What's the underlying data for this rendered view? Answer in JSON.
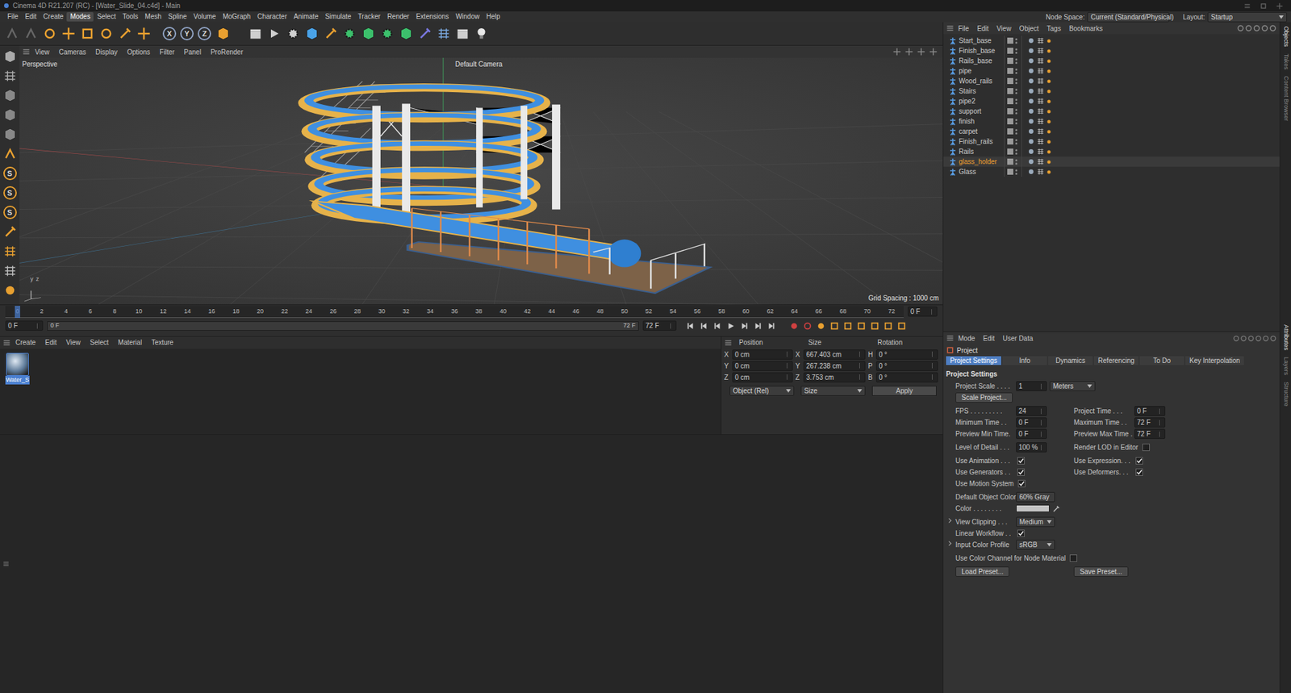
{
  "window": {
    "title": "Cinema 4D R21.207 (RC) - [Water_Slide_04.c4d] - Main"
  },
  "menu": [
    {
      "label": "File",
      "selected": false
    },
    {
      "label": "Edit",
      "selected": false
    },
    {
      "label": "Create",
      "selected": false
    },
    {
      "label": "Modes",
      "selected": true
    },
    {
      "label": "Select",
      "selected": false
    },
    {
      "label": "Tools",
      "selected": false
    },
    {
      "label": "Mesh",
      "selected": false
    },
    {
      "label": "Spline",
      "selected": false
    },
    {
      "label": "Volume",
      "selected": false
    },
    {
      "label": "MoGraph",
      "selected": false
    },
    {
      "label": "Character",
      "selected": false
    },
    {
      "label": "Animate",
      "selected": false
    },
    {
      "label": "Simulate",
      "selected": false
    },
    {
      "label": "Tracker",
      "selected": false
    },
    {
      "label": "Render",
      "selected": false
    },
    {
      "label": "Extensions",
      "selected": false
    },
    {
      "label": "Window",
      "selected": false
    },
    {
      "label": "Help",
      "selected": false
    }
  ],
  "node_space": {
    "label": "Node Space:",
    "value": "Current (Standard/Physical)"
  },
  "layout": {
    "label": "Layout:",
    "value": "Startup"
  },
  "axis_buttons": [
    "X",
    "Y",
    "Z"
  ],
  "left_tools": [
    "S",
    "S",
    "S"
  ],
  "viewport": {
    "menu": [
      "View",
      "Cameras",
      "Display",
      "Options",
      "Filter",
      "Panel",
      "ProRender"
    ],
    "view_name": "Perspective",
    "camera": "Default Camera",
    "grid_spacing": "Grid Spacing : 1000 cm",
    "axis_labels": [
      "y",
      "z"
    ]
  },
  "timeline": {
    "ticks": [
      "0",
      "2",
      "4",
      "6",
      "8",
      "10",
      "12",
      "14",
      "16",
      "18",
      "20",
      "22",
      "24",
      "26",
      "28",
      "30",
      "32",
      "34",
      "36",
      "38",
      "40",
      "42",
      "44",
      "46",
      "48",
      "50",
      "52",
      "54",
      "56",
      "58",
      "60",
      "62",
      "64",
      "66",
      "68",
      "70",
      "72"
    ],
    "playhead": 0,
    "current_frame": "0 F",
    "start_field": "0 F",
    "range_start": "0 F",
    "range_end": "72 F",
    "end_field": "72 F"
  },
  "materials": {
    "menu": [
      "Create",
      "Edit",
      "View",
      "Select",
      "Material",
      "Texture"
    ],
    "items": [
      {
        "name": "Water_S",
        "selected": true
      }
    ]
  },
  "coordinates": {
    "headers": [
      "Position",
      "Size",
      "Rotation"
    ],
    "rows": [
      {
        "axis": "X",
        "position": "0 cm",
        "size_axis": "X",
        "size": "667.403 cm",
        "rot_axis": "H",
        "rotation": "0 °"
      },
      {
        "axis": "Y",
        "position": "0 cm",
        "size_axis": "Y",
        "size": "267.238 cm",
        "rot_axis": "P",
        "rotation": "0 °"
      },
      {
        "axis": "Z",
        "position": "0 cm",
        "size_axis": "Z",
        "size": "3.753 cm",
        "rot_axis": "B",
        "rotation": "0 °"
      }
    ],
    "mode": "Object (Rel)",
    "size_mode": "Size",
    "apply": "Apply"
  },
  "objects": {
    "menu": [
      "File",
      "Edit",
      "View",
      "Object",
      "Tags",
      "Bookmarks"
    ],
    "items": [
      {
        "name": "Start_base",
        "selected": false
      },
      {
        "name": "Finish_base",
        "selected": false
      },
      {
        "name": "Rails_base",
        "selected": false
      },
      {
        "name": "pipe",
        "selected": false
      },
      {
        "name": "Wood_rails",
        "selected": false
      },
      {
        "name": "Stairs",
        "selected": false
      },
      {
        "name": "pipe2",
        "selected": false
      },
      {
        "name": "support",
        "selected": false
      },
      {
        "name": "finish",
        "selected": false
      },
      {
        "name": "carpet",
        "selected": false
      },
      {
        "name": "Finish_rails",
        "selected": false
      },
      {
        "name": "Rails",
        "selected": false
      },
      {
        "name": "glass_holder",
        "selected": true
      },
      {
        "name": "Glass",
        "selected": false
      }
    ]
  },
  "attributes": {
    "menu": [
      "Mode",
      "Edit",
      "User Data"
    ],
    "title": "Project",
    "tabs": [
      {
        "label": "Project Settings",
        "selected": true
      },
      {
        "label": "Info",
        "selected": false
      },
      {
        "label": "Dynamics",
        "selected": false
      },
      {
        "label": "Referencing",
        "selected": false
      },
      {
        "label": "To Do",
        "selected": false
      },
      {
        "label": "Key Interpolation",
        "selected": false
      }
    ],
    "section": "Project Settings",
    "rows": [
      [
        {
          "kind": "number_unit",
          "label": "Project Scale . . . .",
          "value": "1",
          "unit": "Meters"
        }
      ],
      [
        {
          "kind": "button",
          "label": "Scale Project..."
        }
      ],
      [
        {
          "kind": "number",
          "label": "FPS . . . . . . . . .",
          "value": "24"
        },
        {
          "kind": "number",
          "label": "Project Time . . .",
          "value": "0 F"
        }
      ],
      [
        {
          "kind": "number",
          "label": "Minimum Time . .",
          "value": "0 F"
        },
        {
          "kind": "number",
          "label": "Maximum Time . .",
          "value": "72 F"
        }
      ],
      [
        {
          "kind": "number",
          "label": "Preview Min Time.",
          "value": "0 F"
        },
        {
          "kind": "number",
          "label": "Preview Max Time .",
          "value": "72 F"
        }
      ],
      [
        {
          "kind": "number",
          "label": "Level of Detail . . .",
          "value": "100 %"
        },
        {
          "kind": "checkbox",
          "label": "Render LOD in Editor",
          "checked": false
        }
      ],
      [
        {
          "kind": "checkbox",
          "label": "Use Animation . . .",
          "checked": true
        },
        {
          "kind": "checkbox",
          "label": "Use Expression. . .",
          "checked": true
        }
      ],
      [
        {
          "kind": "checkbox",
          "label": "Use Generators . .",
          "checked": true
        },
        {
          "kind": "checkbox",
          "label": "Use Deformers. . .",
          "checked": true
        }
      ],
      [
        {
          "kind": "checkbox",
          "label": "Use Motion System",
          "checked": true
        }
      ],
      [
        {
          "kind": "dropdown",
          "label": "Default Object Color",
          "value": "60% Gray",
          "expandable": false
        }
      ],
      [
        {
          "kind": "color",
          "label": "Color . . . . . . . .",
          "color": "#c4c4c4"
        }
      ],
      [
        {
          "kind": "dropdown",
          "label": "View Clipping . . .",
          "value": "Medium",
          "expandable": true
        }
      ],
      [
        {
          "kind": "checkbox",
          "label": "Linear Workflow . .",
          "checked": true
        }
      ],
      [
        {
          "kind": "dropdown",
          "label": "Input Color Profile",
          "value": "sRGB",
          "expandable": true
        }
      ],
      [
        {
          "kind": "checkbox",
          "label": "Use Color Channel for Node Material",
          "checked": false
        }
      ],
      [
        {
          "kind": "button",
          "label": "Load Preset..."
        },
        {
          "kind": "button",
          "label": "Save Preset..."
        }
      ]
    ]
  },
  "side_tabs": {
    "top": [
      "Objects",
      "Takes",
      "Content Browser"
    ],
    "bottom": [
      "Attributes",
      "Layers",
      "Structure"
    ]
  }
}
